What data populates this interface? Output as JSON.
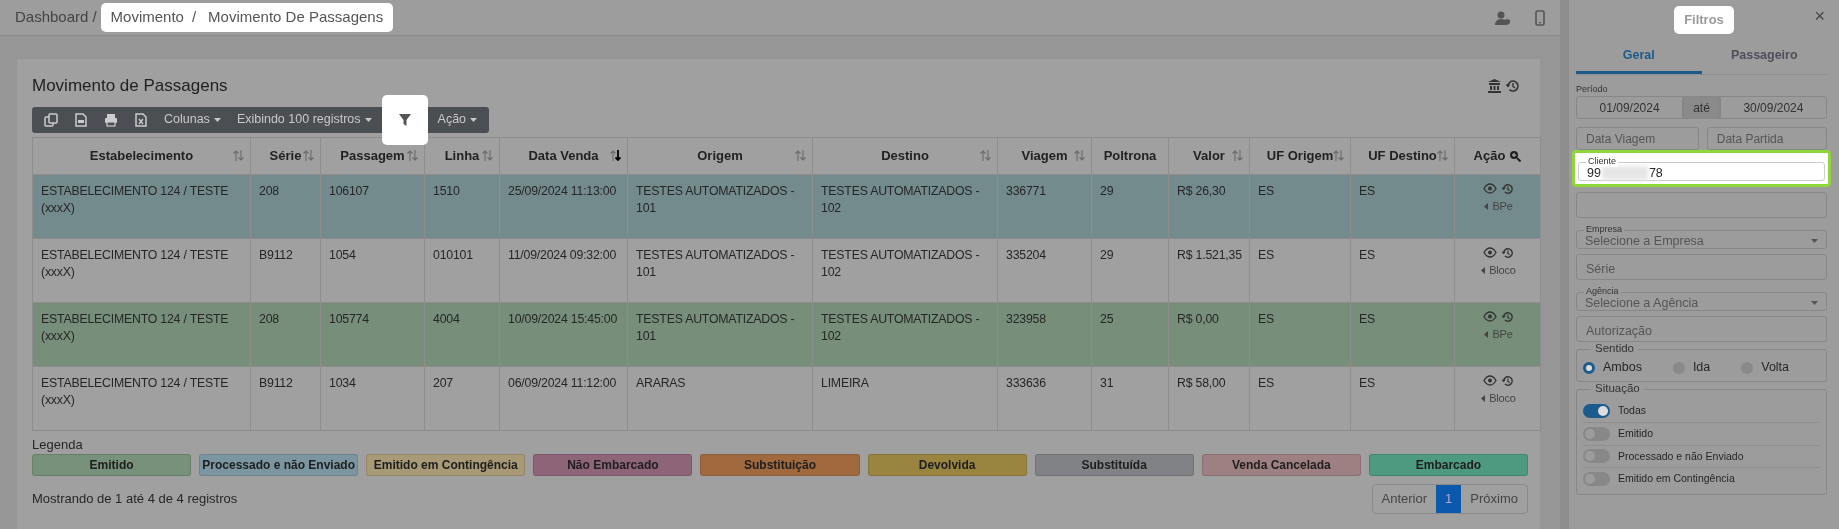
{
  "topbar": {
    "breadcrumb": [
      {
        "label": "Dashboard",
        "separator": "/",
        "highlighted": false
      },
      {
        "label": "Movimento",
        "separator": "/",
        "highlighted": true
      },
      {
        "label": "Movimento De Passagens",
        "highlighted": true
      }
    ]
  },
  "card": {
    "title": "Movimento de Passagens",
    "toolbar": [
      {
        "kind": "dropdown",
        "label": "Colunas"
      },
      {
        "kind": "dropdown",
        "label": "Exibindo 100 registros"
      },
      {
        "kind": "filter",
        "highlighted": true
      },
      {
        "kind": "dropdown",
        "label": "Ação"
      }
    ],
    "columns": [
      {
        "label": "Estabelecimento",
        "sortable": true,
        "sorted": false,
        "search": false
      },
      {
        "label": "Série",
        "sortable": true,
        "sorted": false,
        "search": false
      },
      {
        "label": "Passagem",
        "sortable": true,
        "sorted": false,
        "search": false
      },
      {
        "label": "Linha",
        "sortable": true,
        "sorted": false,
        "search": false
      },
      {
        "label": "Data Venda",
        "sortable": true,
        "sorted": true,
        "search": false
      },
      {
        "label": "Origem",
        "sortable": true,
        "sorted": false,
        "search": false
      },
      {
        "label": "Destino",
        "sortable": true,
        "sorted": false,
        "search": false
      },
      {
        "label": "Viagem",
        "sortable": true,
        "sorted": false,
        "search": false
      },
      {
        "label": "Poltrona",
        "sortable": false,
        "sorted": false,
        "search": false
      },
      {
        "label": "Valor",
        "sortable": true,
        "sorted": false,
        "search": false
      },
      {
        "label": "UF Origem",
        "sortable": true,
        "sorted": false,
        "search": false
      },
      {
        "label": "UF Destino",
        "sortable": true,
        "sorted": false,
        "search": false
      },
      {
        "label": "Ação",
        "sortable": false,
        "sorted": false,
        "search": true
      }
    ],
    "rows": [
      {
        "color": "#748b8d",
        "cells": [
          "ESTABELECIMENTO 124 / TESTE (xxxX)",
          "208",
          "106107",
          "1510",
          "25/09/2024 11:13:00",
          "TESTES AUTOMATIZADOS - 101",
          "TESTES AUTOMATIZADOS - 102",
          "336771",
          "29",
          "R$ 26,30",
          "ES",
          "ES"
        ],
        "action": "BPe"
      },
      {
        "cells": [
          "ESTABELECIMENTO 124 / TESTE (xxxX)",
          "B9112",
          "1054",
          "010101",
          "11/09/2024 09:32:00",
          "TESTES AUTOMATIZADOS - 101",
          "TESTES AUTOMATIZADOS - 102",
          "335204",
          "29",
          "R$ 1.521,35",
          "ES",
          "ES"
        ],
        "action": "Bloco"
      },
      {
        "color": "#778e7b",
        "cells": [
          "ESTABELECIMENTO 124 / TESTE (xxxX)",
          "208",
          "105774",
          "4004",
          "10/09/2024 15:45:00",
          "TESTES AUTOMATIZADOS - 101",
          "TESTES AUTOMATIZADOS - 102",
          "323958",
          "25",
          "R$ 0,00",
          "ES",
          "ES"
        ],
        "action": "BPe"
      },
      {
        "cells": [
          "ESTABELECIMENTO 124 / TESTE (xxxX)",
          "B9112",
          "1034",
          "207",
          "06/09/2024 11:12:00",
          "ARARAS",
          "LIMEIRA",
          "333636",
          "31",
          "R$ 58,00",
          "ES",
          "ES"
        ],
        "action": "Bloco"
      }
    ],
    "legend_title": "Legenda",
    "legend": [
      {
        "label": "Emitido",
        "color": "#77917a"
      },
      {
        "label": "Processado e não Enviado",
        "color": "#7b96a0"
      },
      {
        "label": "Emitido em Contingência",
        "color": "#a89a76"
      },
      {
        "label": "Não Embarcado",
        "color": "#8e6479"
      },
      {
        "label": "Substituição",
        "color": "#a06a3e"
      },
      {
        "label": "Devolvida",
        "color": "#9a8540"
      },
      {
        "label": "Substituída",
        "color": "#808285"
      },
      {
        "label": "Venda Cancelada",
        "color": "#9e7f82"
      },
      {
        "label": "Embarcado",
        "color": "#4e9a80"
      }
    ],
    "info": "Mostrando de 1 até 4 de 4 registros",
    "pagination": [
      {
        "label": "Anterior",
        "selected": false
      },
      {
        "label": "1",
        "selected": true
      },
      {
        "label": "Próximo",
        "selected": false
      }
    ]
  },
  "filters": {
    "title": "Filtros",
    "close": "×",
    "tabs": [
      {
        "label": "Geral",
        "selected": true
      },
      {
        "label": "Passageiro",
        "selected": false
      }
    ],
    "period": {
      "label": "Período",
      "start": "01/09/2024",
      "separator": "até",
      "end": "30/09/2024"
    },
    "date_fields": [
      {
        "placeholder": "Data Viagem"
      },
      {
        "placeholder": "Data Partida"
      }
    ],
    "client": {
      "label": "Cliente",
      "value_start": "99",
      "redacted": true,
      "value_end": "78",
      "highlighted": true
    },
    "fields": [
      {
        "kind": "input"
      },
      {
        "kind": "select",
        "label": "Empresa",
        "placeholder": "Selecione a Empresa"
      },
      {
        "kind": "input",
        "placeholder": "Série"
      },
      {
        "kind": "select",
        "label": "Agência",
        "placeholder": "Selecione a Agência"
      },
      {
        "kind": "input",
        "placeholder": "Autorização"
      }
    ],
    "direction": {
      "label": "Sentido",
      "options": [
        {
          "label": "Ambos",
          "selected": true
        },
        {
          "label": "Ida",
          "selected": false
        },
        {
          "label": "Volta",
          "selected": false
        }
      ]
    },
    "status": {
      "label": "Situação",
      "options": [
        {
          "label": "Todas",
          "on": true
        },
        {
          "label": "Emitido",
          "on": false
        },
        {
          "label": "Processado e não Enviado",
          "on": false
        },
        {
          "label": "Emitido em Contingência",
          "on": false
        }
      ]
    }
  }
}
